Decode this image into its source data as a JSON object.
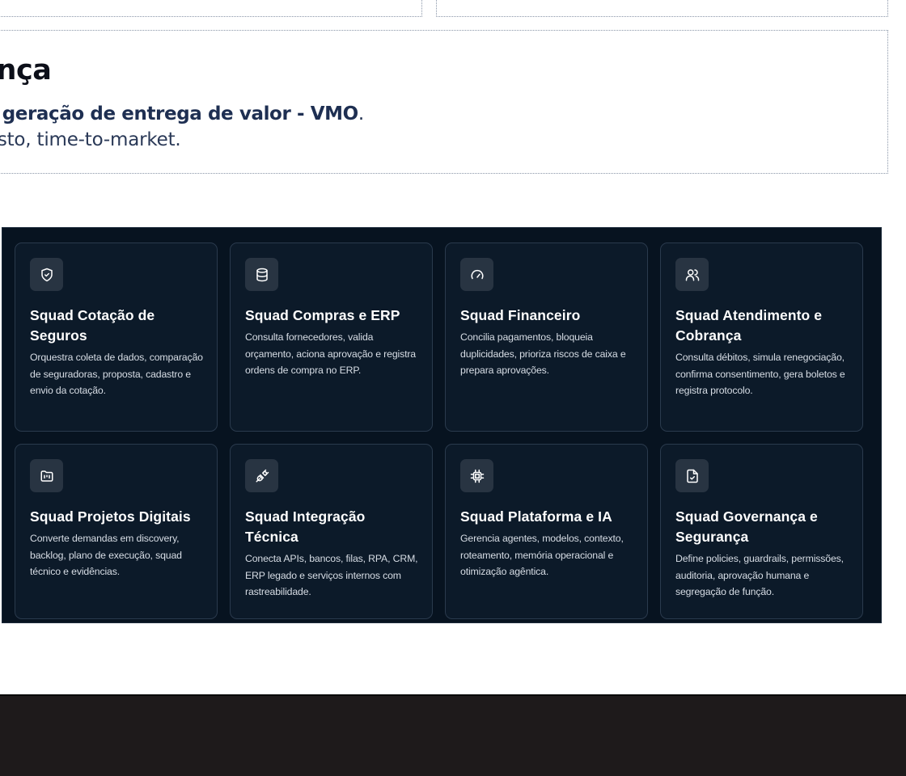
{
  "governance": {
    "title": "nança",
    "line1_strong": "a geração de entrega de valor - VMO",
    "line1_end": ".",
    "line2": "custo, time-to-market."
  },
  "squads": [
    {
      "icon": "shield-check-icon",
      "title": "Squad Cotação de Seguros",
      "desc": "Orquestra coleta de dados, comparação de seguradoras, proposta, cadastro e envio da cotação."
    },
    {
      "icon": "database-icon",
      "title": "Squad Compras e ERP",
      "desc": "Consulta fornecedores, valida orçamento, aciona aprovação e registra ordens de compra no ERP."
    },
    {
      "icon": "gauge-icon",
      "title": "Squad Financeiro",
      "desc": "Concilia pagamentos, bloqueia duplicidades, prioriza riscos de caixa e prepara aprovações."
    },
    {
      "icon": "users-icon",
      "title": "Squad Atendimento e Cobrança",
      "desc": "Consulta débitos, simula renegociação, confirma consentimento, gera boletos e registra protocolo."
    },
    {
      "icon": "folder-kanban-icon",
      "title": "Squad Projetos Digitais",
      "desc": "Converte demandas em discovery, backlog, plano de execução, squad técnico e evidências."
    },
    {
      "icon": "plug-icon",
      "title": "Squad Integração Técnica",
      "desc": "Conecta APIs, bancos, filas, RPA, CRM, ERP legado e serviços internos com rastreabilidade."
    },
    {
      "icon": "cpu-icon",
      "title": "Squad Plataforma e IA",
      "desc": "Gerencia agentes, modelos, contexto, roteamento, memória operacional e otimização agêntica."
    },
    {
      "icon": "file-check-icon",
      "title": "Squad Governança e Segurança",
      "desc": "Define policies, guardrails, permissões, auditoria, aprovação humana e segregação de função."
    }
  ],
  "colors": {
    "panel_bg": "#071320",
    "card_bg": "#0c1a29",
    "icon_bg": "#283442",
    "accent_text": "#1e2f52",
    "footer_bg": "#1e1a1b"
  }
}
